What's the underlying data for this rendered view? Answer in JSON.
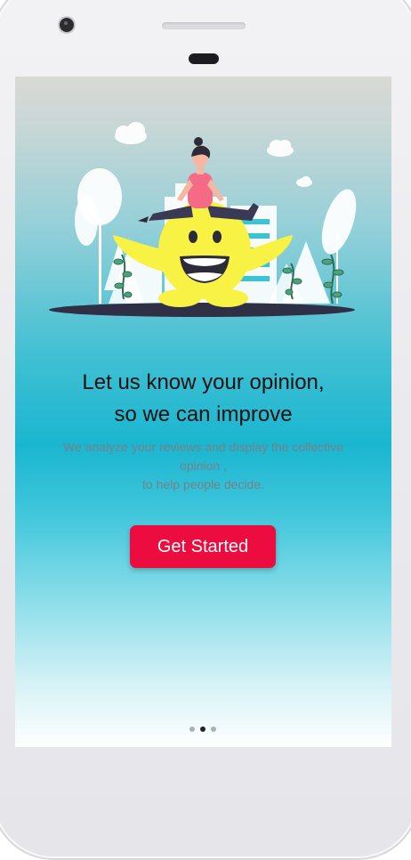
{
  "onboarding": {
    "headline_line1": "Let us know your opinion,",
    "headline_line2": "so we can improve",
    "description_line1": "We analyze your reviews and display the collective opinion ,",
    "description_line2": "to help people decide.",
    "cta_label": "Get Started",
    "current_page": 2,
    "total_pages": 3
  },
  "colors": {
    "accent": "#ec0c3f",
    "background_teal": "#1ab6d0",
    "mascot_yellow": "#f7f243",
    "headline": "#111111",
    "description": "#7a7f86"
  },
  "icons": {
    "illustration": "woman-leaping-over-smiley-mascot",
    "page_dots": "pagination-dots"
  }
}
